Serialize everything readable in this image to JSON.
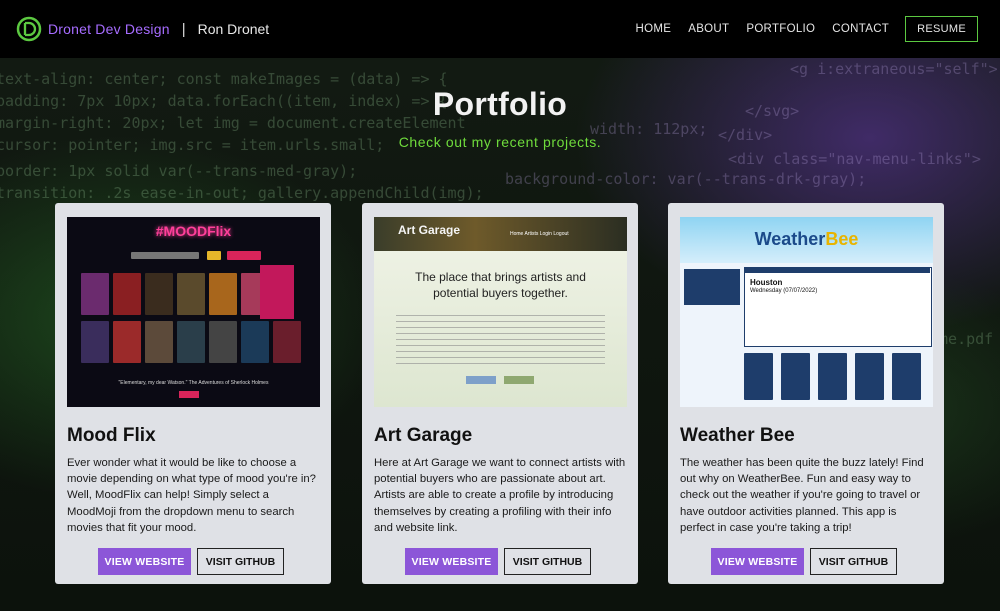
{
  "header": {
    "brand": "Dronet Dev Design",
    "separator": "|",
    "owner": "Ron Dronet",
    "nav": [
      "HOME",
      "ABOUT",
      "PORTFOLIO",
      "CONTACT"
    ],
    "resume": "RESUME",
    "accent": "#a66cff",
    "logo_color": "#5cc941"
  },
  "background_code": [
    "text-align: center;   const makeImages = (data) => {",
    "padding: 7px 10px;      data.forEach((item, index) => {",
    "margin-right: 20px;        let img = document.createElement",
    "cursor: pointer;           img.src = item.urls.small;",
    "border: 1px solid var(--trans-med-gray);",
    "transition: .2s ease-in-out;  gallery.appendChild(img);"
  ],
  "background_code_right": [
    "<g i:extraneous=\"self\">",
    "</svg>",
    "width: 112px;",
    "</div>",
    "<div class=\"nav-menu-links\">",
    "background-color: var(--trans-drk-gray);",
    "ume.pdf"
  ],
  "hero": {
    "title": "Portfolio",
    "subtitle": "Check out my recent projects."
  },
  "projects": [
    {
      "title": "Mood Flix",
      "description": "Ever wonder what it would be like to choose a movie depending on what type of mood you're in? Well, MoodFlix can help! Simply select a MoodMoji from the dropdown menu to search movies that fit your mood.",
      "website_label": "VIEW WEBSITE",
      "github_label": "VISIT GITHUB",
      "preview": {
        "logo": "#MOODFlix",
        "quote": "\"Elementary, my dear Watson.\" The Adventures of Sherlock Holmes"
      }
    },
    {
      "title": "Art Garage",
      "description": "Here at Art Garage we want to connect artists with potential buyers who are passionate about art. Artists are able to create a profile by introducing themselves by creating a profiling with their info and website link.",
      "website_label": "VIEW WEBSITE",
      "github_label": "VISIT GITHUB",
      "preview": {
        "logo": "Art Garage",
        "nav": "Home   Artists   Login   Logout",
        "headline": "The place that brings artists and potential buyers together."
      }
    },
    {
      "title": "Weather Bee",
      "description": "The weather has been quite the buzz lately! Find out why on WeatherBee. Fun and easy way to check out the weather if you're going to travel or have outdoor activities planned. This app is perfect in case you're taking a trip!",
      "website_label": "VIEW WEBSITE",
      "github_label": "VISIT GITHUB",
      "preview": {
        "logo_a": "Weather",
        "logo_b": "Bee",
        "city": "Houston",
        "date": "Wednesday (07/07/2022)"
      }
    }
  ],
  "colors": {
    "card_bg": "#dfe1e6",
    "primary_button": "#8c56d8",
    "subtitle": "#6fdc3c"
  }
}
